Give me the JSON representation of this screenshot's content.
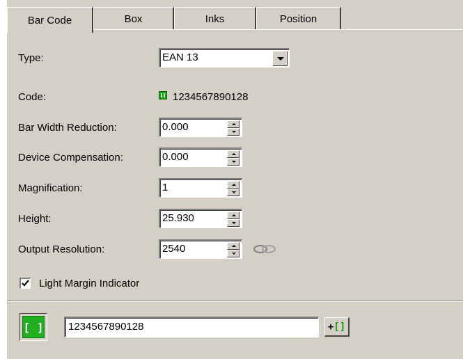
{
  "tabs": [
    {
      "label": "Bar Code",
      "active": true
    },
    {
      "label": "Box",
      "active": false
    },
    {
      "label": "Inks",
      "active": false
    },
    {
      "label": "Position",
      "active": false
    }
  ],
  "type": {
    "label": "Type:",
    "value": "EAN 13"
  },
  "code": {
    "label": "Code:",
    "value": "1234567890128",
    "icon": "barcode-green-icon"
  },
  "bar_width_reduction": {
    "label": "Bar Width Reduction:",
    "value": "0.000"
  },
  "device_compensation": {
    "label": "Device Compensation:",
    "value": "0.000"
  },
  "magnification": {
    "label": "Magnification:",
    "value": "1"
  },
  "height": {
    "label": "Height:",
    "value": "25.930"
  },
  "output_resolution": {
    "label": "Output Resolution:",
    "value": "2540",
    "link_icon": "chain-link-icon"
  },
  "light_margin": {
    "label": "Light Margin Indicator",
    "checked": true
  },
  "bottom": {
    "input_value": "1234567890128",
    "green_button_glyph": "[ ]",
    "add_button_plus": "+",
    "add_button_brackets": "[]"
  },
  "colors": {
    "panel_bg": "#d4d0c8",
    "accent_green": "#22b022"
  }
}
